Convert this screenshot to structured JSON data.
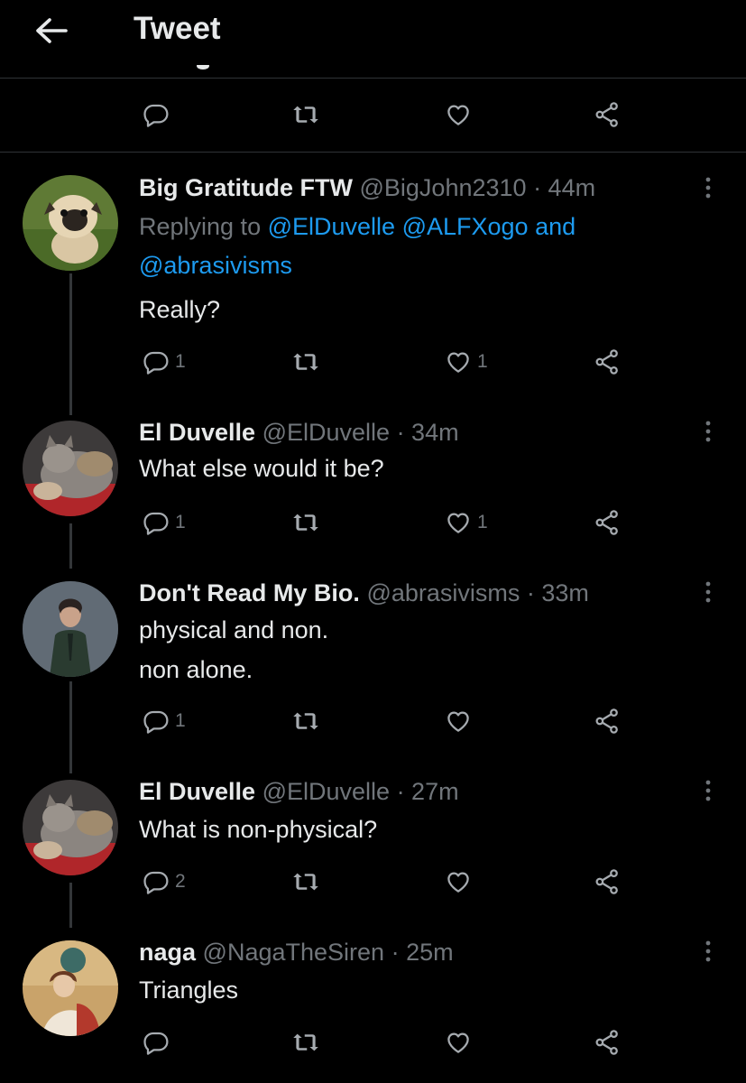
{
  "header": {
    "title": "Tweet",
    "back_icon": "arrow-left-icon"
  },
  "colors": {
    "background": "#000000",
    "text": "#e7e9ea",
    "muted": "#71767b",
    "link": "#1d9bf0",
    "divider": "#2f3336"
  },
  "tweets": [
    {
      "name": "Big Gratitude FTW",
      "handle": "@BigJohn2310",
      "time": "· 44m",
      "replying_label": "Replying to",
      "mentions": [
        "@ElDuvelle",
        "@ALFXogo",
        "and",
        "@abrasivisms"
      ],
      "text": "Really?",
      "replies": "1",
      "likes": "1"
    },
    {
      "name": "El Duvelle",
      "handle": "@ElDuvelle",
      "time": "· 34m",
      "text": "What else would it be?",
      "replies": "1",
      "likes": "1"
    },
    {
      "name": "Don't Read My Bio.",
      "handle": "@abrasivisms",
      "time": "· 33m",
      "text_lines": [
        "physical and non.",
        "non alone."
      ],
      "replies": "1",
      "likes": ""
    },
    {
      "name": "El Duvelle",
      "handle": "@ElDuvelle",
      "time": "· 27m",
      "text": "What is non-physical?",
      "replies": "2",
      "likes": ""
    },
    {
      "name": "naga",
      "handle": "@NagaTheSiren",
      "time": "· 25m",
      "text": "Triangles",
      "replies": "",
      "likes": ""
    }
  ]
}
